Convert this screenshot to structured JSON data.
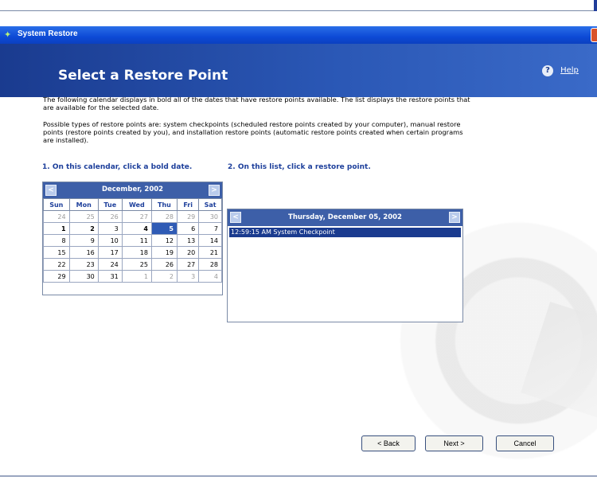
{
  "window": {
    "title": "System Restore"
  },
  "header": {
    "title": "Select a Restore Point",
    "help_label": "Help"
  },
  "instructions": {
    "p1": "The following calendar displays in bold all of the dates that have restore points available. The list displays the restore points that are available for the selected date.",
    "p2": "Possible types of restore points are: system checkpoints (scheduled restore points created by your computer), manual restore points (restore points created by you), and installation restore points (automatic restore points created when certain programs are installed).",
    "step1": "1. On this calendar, click a bold date.",
    "step2": "2. On this list, click a restore point."
  },
  "calendar": {
    "prev": "<",
    "next": ">",
    "month": "December, 2002",
    "day_headers": [
      "Sun",
      "Mon",
      "Tue",
      "Wed",
      "Thu",
      "Fri",
      "Sat"
    ],
    "weeks": [
      [
        "24",
        "25",
        "26",
        "27",
        "28",
        "29",
        "30"
      ],
      [
        "1",
        "2",
        "3",
        "4",
        "5",
        "6",
        "7"
      ],
      [
        "8",
        "9",
        "10",
        "11",
        "12",
        "13",
        "14"
      ],
      [
        "15",
        "16",
        "17",
        "18",
        "19",
        "20",
        "21"
      ],
      [
        "22",
        "23",
        "24",
        "25",
        "26",
        "27",
        "28"
      ],
      [
        "29",
        "30",
        "31",
        "1",
        "2",
        "3",
        "4"
      ]
    ],
    "selected_date": "5"
  },
  "restore_list": {
    "prev": "<",
    "next": ">",
    "date": "Thursday, December 05, 2002",
    "items": [
      "12:59:15 AM  System Checkpoint"
    ]
  },
  "buttons": {
    "back": "< Back",
    "next": "Next >",
    "cancel": "Cancel"
  }
}
